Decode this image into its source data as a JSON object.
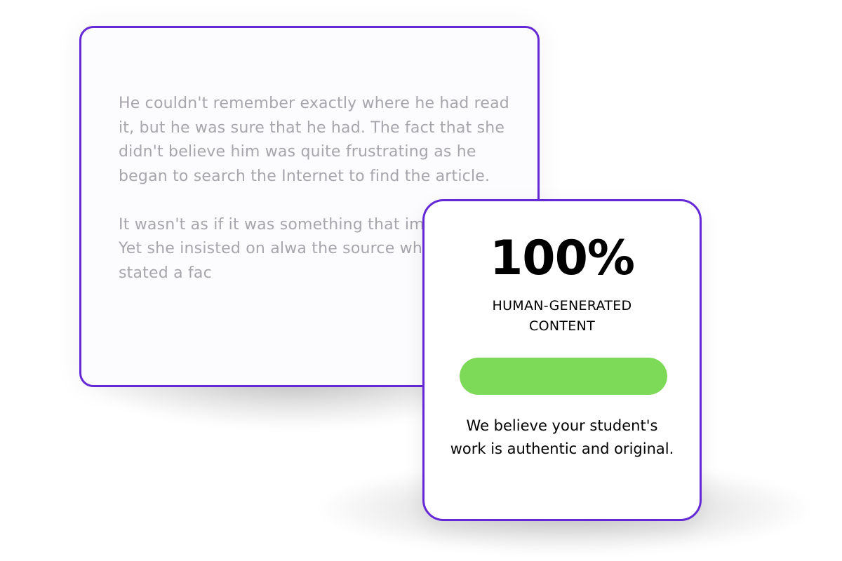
{
  "document": {
    "paragraphs": [
      "He couldn't remember exactly where he had read it, but he was sure that he had. The fact that she didn't believe him was quite frustrating as he began to search the Internet to find the article.",
      "It wasn't as if it was something that impossible. Yet she insisted on alwa the source whenever he stated a fac"
    ]
  },
  "result": {
    "score": "100%",
    "label": "HUMAN-GENERATED CONTENT",
    "progress_percent": 100,
    "verdict": "We believe your student's work is authentic and original."
  },
  "colors": {
    "accent_border": "#6428d6",
    "progress_fill": "#7dd958",
    "document_text": "#a8a6ad"
  }
}
